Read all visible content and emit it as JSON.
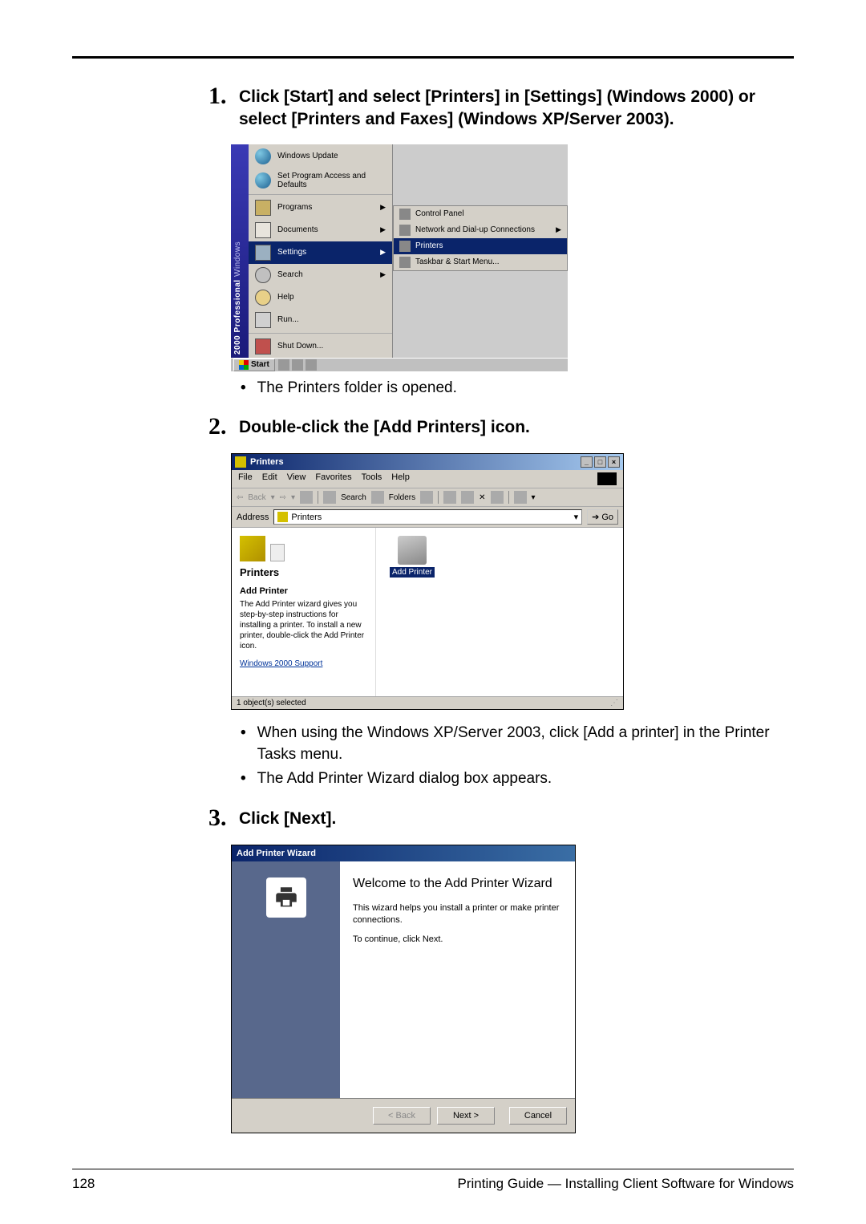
{
  "steps": {
    "s1": {
      "num": "1.",
      "text": "Click [Start] and select [Printers] in [Settings] (Windows 2000) or select [Printers and Faxes] (Windows XP/Server 2003).",
      "bullets": [
        "The Printers folder is opened."
      ]
    },
    "s2": {
      "num": "2.",
      "text": "Double-click the [Add Printers] icon.",
      "bullets": [
        "When using the Windows XP/Server 2003, click [Add a printer] in the Printer Tasks menu.",
        "The Add Printer Wizard dialog box appears."
      ]
    },
    "s3": {
      "num": "3.",
      "text": "Click [Next]."
    }
  },
  "ss1": {
    "sidebar_brand": "Windows",
    "sidebar_edition": "2000 Professional",
    "items": {
      "update": "Windows Update",
      "defaults": "Set Program Access and Defaults",
      "programs": "Programs",
      "documents": "Documents",
      "settings": "Settings",
      "search": "Search",
      "help": "Help",
      "run": "Run...",
      "shutdown": "Shut Down..."
    },
    "submenu": {
      "control": "Control Panel",
      "network": "Network and Dial-up Connections",
      "printers": "Printers",
      "taskbar": "Taskbar & Start Menu..."
    },
    "start": "Start"
  },
  "ss2": {
    "title": "Printers",
    "menus": {
      "file": "File",
      "edit": "Edit",
      "view": "View",
      "fav": "Favorites",
      "tools": "Tools",
      "help": "Help"
    },
    "toolbar": {
      "back": "Back",
      "search": "Search",
      "folders": "Folders"
    },
    "address_label": "Address",
    "address_value": "Printers",
    "go": "Go",
    "left": {
      "heading": "Printers",
      "subhead": "Add Printer",
      "desc": "The Add Printer wizard gives you step-by-step instructions for installing a printer. To install a new printer, double-click the Add Printer icon.",
      "link": "Windows 2000 Support"
    },
    "icon_label": "Add Printer",
    "status": "1 object(s) selected"
  },
  "ss3": {
    "title": "Add Printer Wizard",
    "heading": "Welcome to the Add Printer Wizard",
    "p1": "This wizard helps you install a printer or make printer connections.",
    "p2": "To continue, click Next.",
    "back": "< Back",
    "next": "Next >",
    "cancel": "Cancel"
  },
  "footer": {
    "page": "128",
    "title": "Printing Guide — Installing Client Software for Windows"
  }
}
